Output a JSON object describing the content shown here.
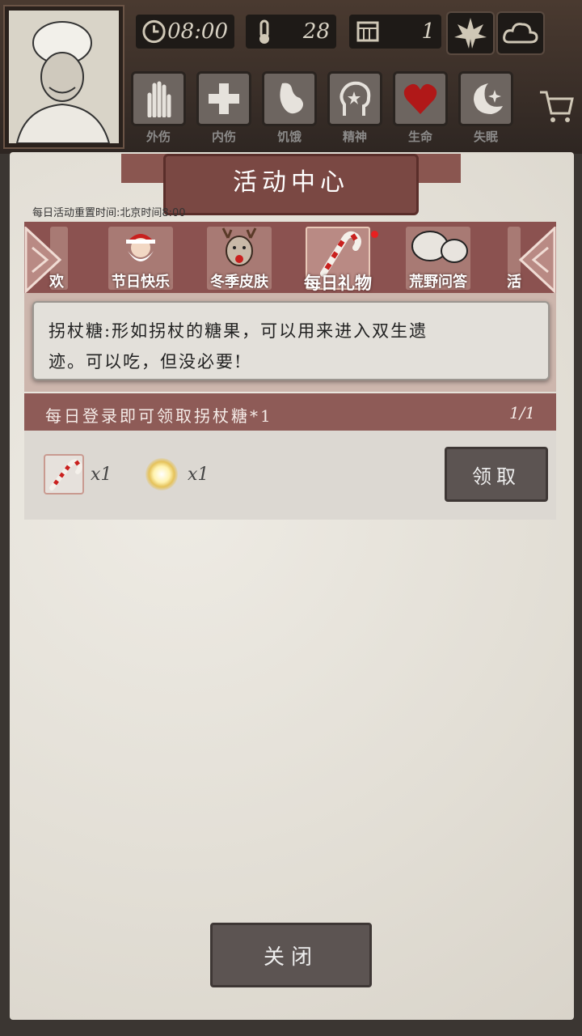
{
  "hud": {
    "time": "08:00",
    "temperature": "28",
    "day": "1",
    "icons": [
      "clock-icon",
      "thermometer-icon",
      "calendar-icon",
      "leaf-icon",
      "cloud-icon"
    ]
  },
  "status": [
    {
      "label": "外伤",
      "icon": "hand-icon"
    },
    {
      "label": "内伤",
      "icon": "cross-icon"
    },
    {
      "label": "饥饿",
      "icon": "stomach-icon"
    },
    {
      "label": "精神",
      "icon": "head-icon"
    },
    {
      "label": "生命",
      "icon": "heart-icon"
    },
    {
      "label": "失眠",
      "icon": "moon-icon"
    }
  ],
  "panel": {
    "title": "活动中心",
    "reset_note": "每日活动重置时间:北京时间8:00"
  },
  "tabs": [
    {
      "label": "欢",
      "partial": true
    },
    {
      "label": "节日快乐"
    },
    {
      "label": "冬季皮肤"
    },
    {
      "label": "每日礼物",
      "active": true
    },
    {
      "label": "荒野问答"
    },
    {
      "label": "活",
      "partial": true
    }
  ],
  "tooltip": {
    "line1": "拐杖糖:形如拐杖的糖果，可以用来进入双生遗",
    "line2": "迹。可以吃，但没必要!"
  },
  "task": {
    "text": "每日登录即可领取拐杖糖*1",
    "count": "1/1"
  },
  "rewards": [
    {
      "icon": "candy-cane-icon",
      "qty": "x1"
    },
    {
      "icon": "glowing-orb-icon",
      "qty": "x1"
    }
  ],
  "buttons": {
    "claim": "领取",
    "close": "关闭"
  },
  "colors": {
    "tab_strip": "#8b5250",
    "task_bar": "#8e5b57",
    "heart": "#b01818"
  }
}
